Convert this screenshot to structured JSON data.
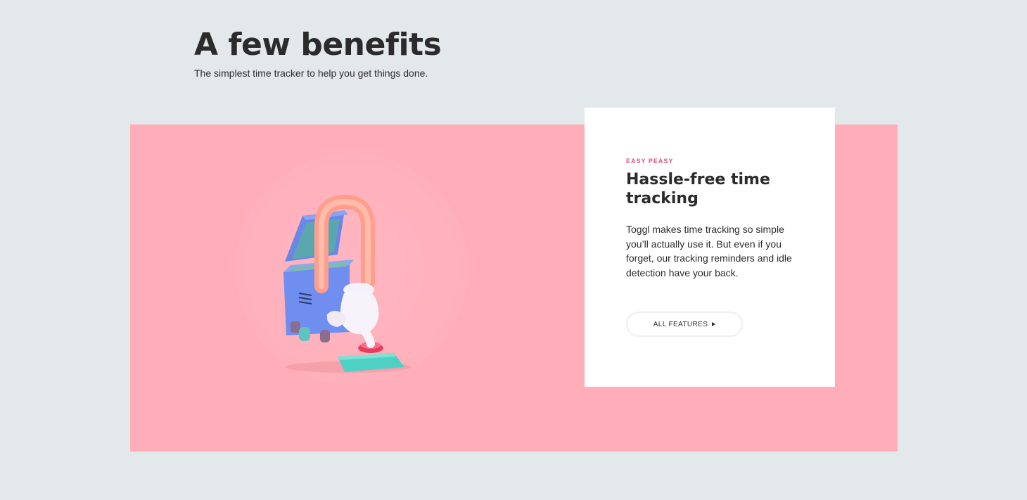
{
  "header": {
    "title": "A few benefits",
    "subtitle": "The simplest time tracker to help you get things done."
  },
  "feature": {
    "eyebrow": "EASY PEASY",
    "title": "Hassle-free time tracking",
    "body": "Toggl makes time tracking so simple you’ll actually use it. But even if you forget, our tracking reminders and idle detection have your back.",
    "button_label": "ALL FEATURES",
    "button_icon": "play-triangle-icon"
  },
  "colors": {
    "background": "#e3e8eb",
    "panel": "#ffaeb9",
    "eyebrow": "#d5557a",
    "text": "#2b2b2b"
  }
}
